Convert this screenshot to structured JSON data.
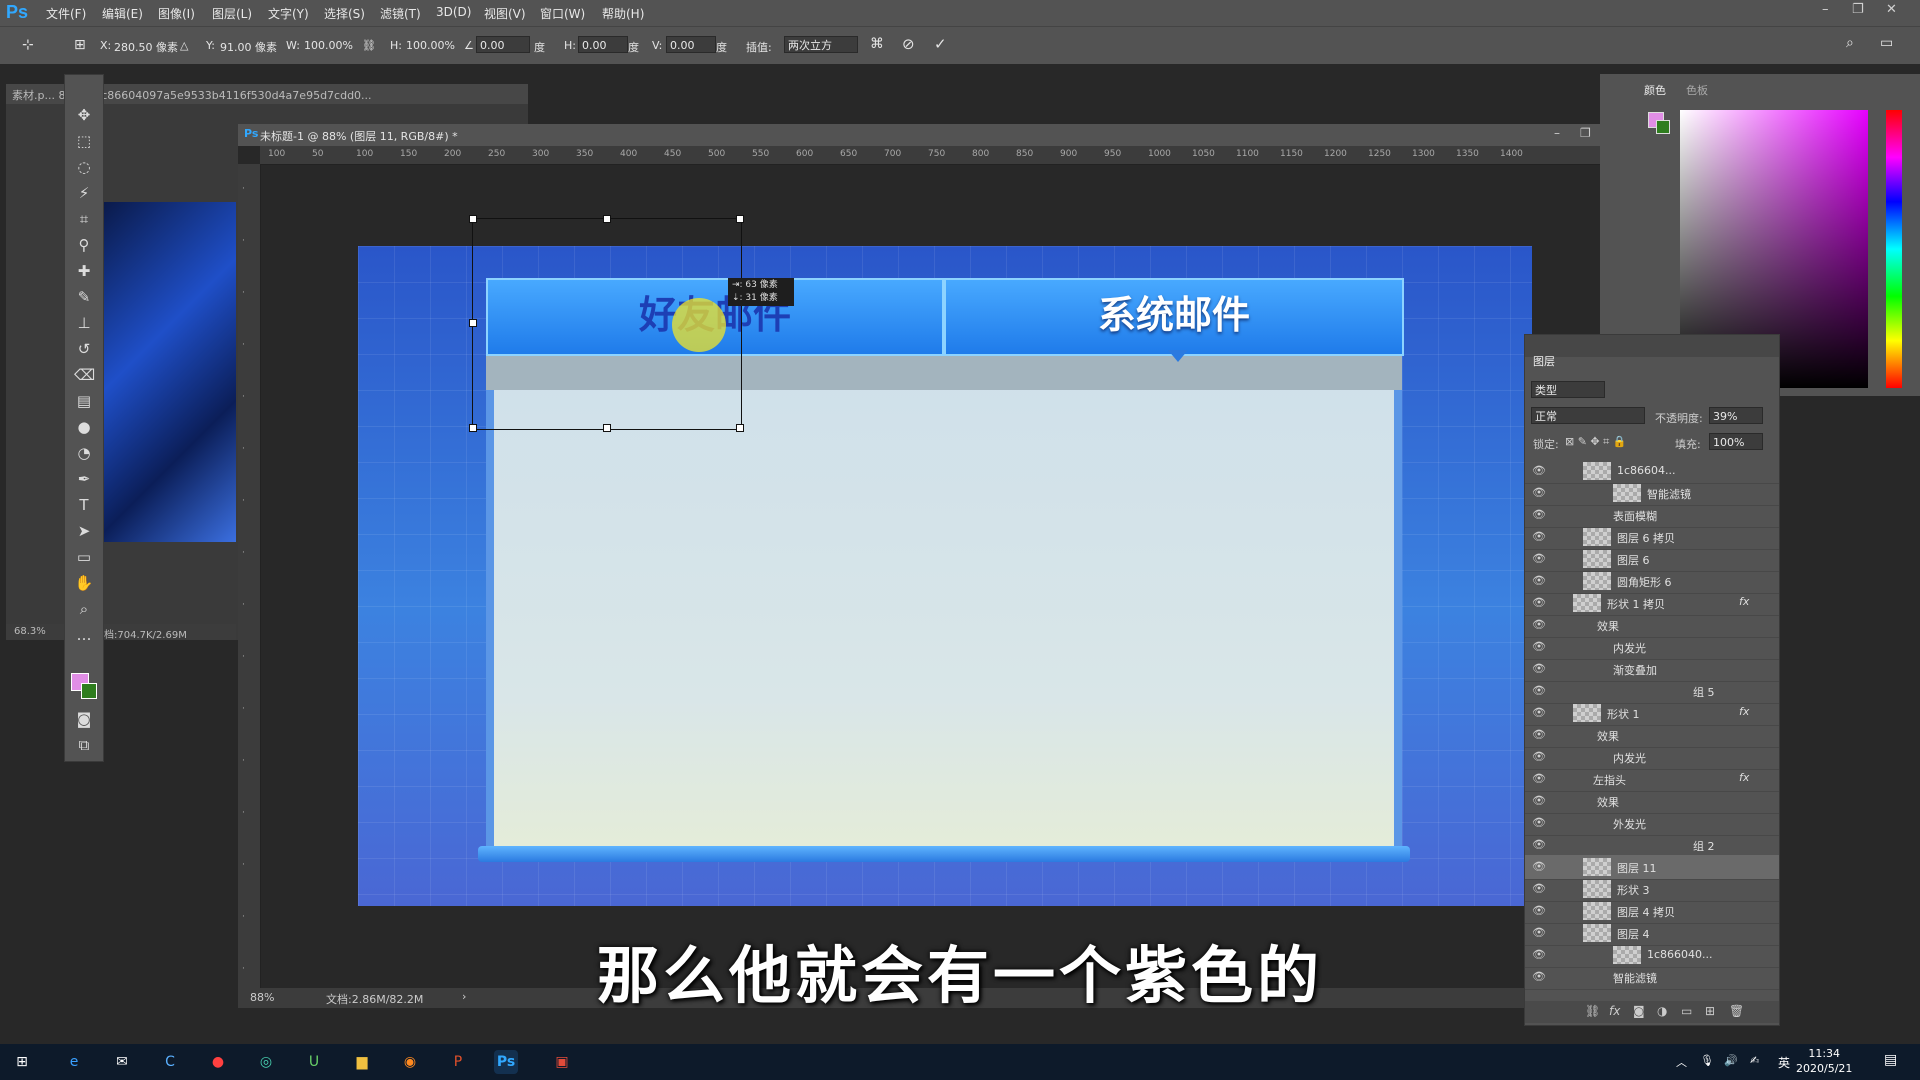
{
  "app": {
    "logo": "Ps"
  },
  "menu": [
    "文件(F)",
    "编辑(E)",
    "图像(I)",
    "图层(L)",
    "文字(Y)",
    "选择(S)",
    "滤镜(T)",
    "3D(D)",
    "视图(V)",
    "窗口(W)",
    "帮助(H)"
  ],
  "options": {
    "x_label": "X:",
    "x_value": "280.50 像素",
    "y_label": "Y:",
    "y_value": "91.00 像素",
    "w_label": "W:",
    "w_value": "100.00%",
    "h_label": "H:",
    "h_value": "100.00%",
    "angle_value": "0.00",
    "deg": "度",
    "hskew_label": "H:",
    "hskew_value": "0.00",
    "vskew_label": "V:",
    "vskew_value": "0.00",
    "interp_label": "插值:",
    "interp_value": "两次立方"
  },
  "doc1": {
    "tab": "素材.p... 8.3% (1c86604097a5e9533b4116f530d4a7e95d7cdd0...",
    "zoom": "68.3%",
    "status": "档:704.7K/2.69M"
  },
  "doc2": {
    "tab": "未标题-1 @ 88% (图层 11, RGB/8#) *",
    "zoom": "88%",
    "status": "文档:2.86M/82.2M",
    "ruler": [
      "100",
      "50",
      "100",
      "150",
      "200",
      "250",
      "300",
      "350",
      "400",
      "450",
      "500",
      "550",
      "600",
      "650",
      "700",
      "750",
      "800",
      "850",
      "900",
      "950",
      "1000",
      "1050",
      "1100",
      "1150",
      "1200",
      "1250",
      "1300",
      "1350",
      "1400"
    ]
  },
  "canvas": {
    "tab_friend": "好友邮件",
    "tab_system": "系统邮件",
    "tooltip_line1": "⇥: 63 像素",
    "tooltip_line2": "⇣: 31 像素"
  },
  "color_panel": {
    "tab_color": "颜色",
    "tab_swatches": "色板"
  },
  "layers_panel": {
    "title": "图层",
    "filter": "类型",
    "blend": "正常",
    "opacity_label": "不透明度:",
    "opacity_value": "39%",
    "lock_label": "锁定:",
    "fill_label": "填充:",
    "fill_value": "100%",
    "rows": [
      {
        "name": "1c86604...",
        "indent": 40,
        "thumb": true
      },
      {
        "name": "智能滤镜",
        "indent": 70,
        "thumb": true
      },
      {
        "name": "表面模糊",
        "indent": 70,
        "thumb": false
      },
      {
        "name": "图层 6 拷贝",
        "indent": 40,
        "thumb": true
      },
      {
        "name": "图层 6",
        "indent": 40,
        "thumb": true
      },
      {
        "name": "圆角矩形 6",
        "indent": 40,
        "thumb": true
      },
      {
        "name": "形状 1 拷贝",
        "indent": 30,
        "thumb": true,
        "fx": "fx"
      },
      {
        "name": "效果",
        "indent": 54,
        "thumb": false
      },
      {
        "name": "内发光",
        "indent": 70,
        "thumb": false
      },
      {
        "name": "渐变叠加",
        "indent": 70,
        "thumb": false
      },
      {
        "name": "组 5",
        "indent": 150,
        "thumb": false
      },
      {
        "name": "形状 1",
        "indent": 30,
        "thumb": true,
        "fx": "fx"
      },
      {
        "name": "效果",
        "indent": 54,
        "thumb": false
      },
      {
        "name": "内发光",
        "indent": 70,
        "thumb": false
      },
      {
        "name": "左指头",
        "indent": 50,
        "thumb": false,
        "fx": "fx"
      },
      {
        "name": "效果",
        "indent": 54,
        "thumb": false
      },
      {
        "name": "外发光",
        "indent": 70,
        "thumb": false
      },
      {
        "name": "组 2",
        "indent": 150,
        "thumb": false
      },
      {
        "name": "图层 11",
        "indent": 40,
        "thumb": true
      },
      {
        "name": "形状 3",
        "indent": 40,
        "thumb": true
      },
      {
        "name": "图层 4 拷贝",
        "indent": 40,
        "thumb": true
      },
      {
        "name": "图层 4",
        "indent": 40,
        "thumb": true
      },
      {
        "name": "1c866040...",
        "indent": 70,
        "thumb": true
      },
      {
        "name": "智能滤镜",
        "indent": 70,
        "thumb": false
      }
    ]
  },
  "subtitle": "那么他就会有一个紫色的",
  "taskbar": {
    "time": "11:34",
    "date": "2020/5/21",
    "ime": "英"
  }
}
